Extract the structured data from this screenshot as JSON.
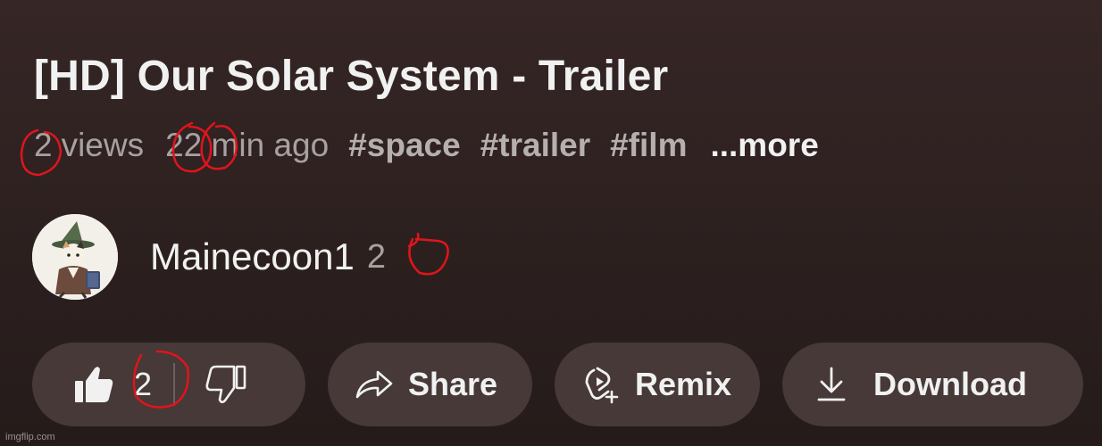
{
  "video": {
    "title": "[HD] Our Solar System - Trailer",
    "views_count": "2",
    "views_word": "views",
    "time_ago": "22 min ago",
    "hashtags": [
      "#space",
      "#trailer",
      "#film"
    ],
    "more_label": "...more"
  },
  "channel": {
    "name": "Mainecoon1",
    "subscriber_count": "2",
    "avatar_icon": "witch-cat-avatar"
  },
  "actions": {
    "like_count": "2",
    "share_label": "Share",
    "remix_label": "Remix",
    "download_label": "Download"
  },
  "colors": {
    "background": "#2f2221",
    "pill": "#463937",
    "annotation": "#e0141c"
  },
  "watermark": "imgflip.com"
}
